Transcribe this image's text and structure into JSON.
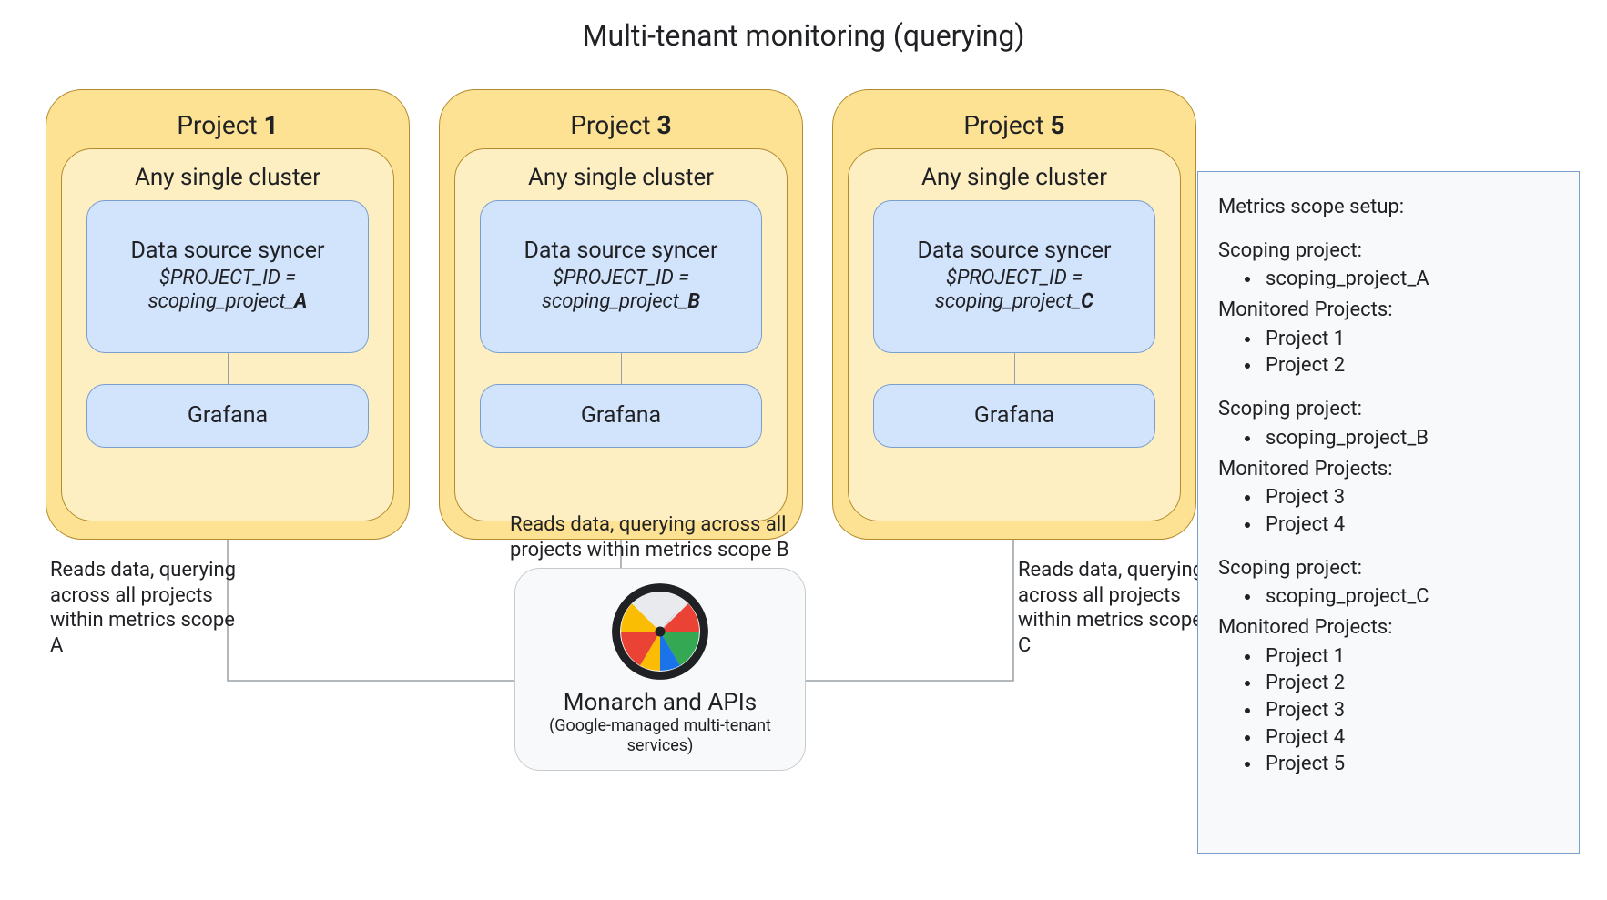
{
  "title": "Multi-tenant monitoring (querying)",
  "cluster_label": "Any single cluster",
  "ds_label": "Data source syncer",
  "grafana_label": "Grafana",
  "project_id_var": "$PROJECT_ID =",
  "projects": [
    {
      "name_prefix": "Project ",
      "name_num": "1",
      "scoping_prefix": "scoping_project_",
      "scoping_suffix": "A",
      "read_text": "Reads data, querying across all projects within metrics scope A"
    },
    {
      "name_prefix": "Project ",
      "name_num": "3",
      "scoping_prefix": "scoping_project_",
      "scoping_suffix": "B",
      "read_text": "Reads data, querying across all projects within metrics scope B"
    },
    {
      "name_prefix": "Project ",
      "name_num": "5",
      "scoping_prefix": "scoping_project_",
      "scoping_suffix": "C",
      "read_text": "Reads data, querying across all projects within metrics scope C"
    }
  ],
  "monarch": {
    "title": "Monarch and APIs",
    "subtitle": "(Google-managed multi-tenant services)"
  },
  "scope_panel": {
    "heading": "Metrics scope setup:",
    "scoping_label": "Scoping project:",
    "monitored_label": "Monitored Projects:",
    "groups": [
      {
        "scoping": "scoping_project_A",
        "monitored": [
          "Project 1",
          "Project 2"
        ]
      },
      {
        "scoping": "scoping_project_B",
        "monitored": [
          "Project 3",
          "Project 4"
        ]
      },
      {
        "scoping": "scoping_project_C",
        "monitored": [
          "Project 1",
          "Project 2",
          "Project 3",
          "Project 4",
          "Project 5"
        ]
      }
    ]
  }
}
